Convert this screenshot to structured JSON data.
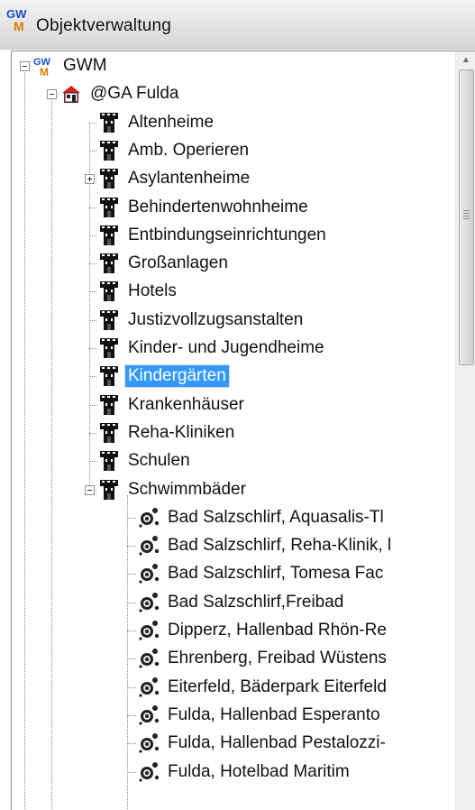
{
  "window": {
    "title": "Objektverwaltung"
  },
  "tree": {
    "root": {
      "label": "GWM",
      "expanded": true
    },
    "office": {
      "label": "@GA Fulda",
      "expanded": true
    },
    "categories": [
      {
        "label": "Altenheime"
      },
      {
        "label": "Amb. Operieren"
      },
      {
        "label": "Asylantenheime",
        "expandable": true
      },
      {
        "label": "Behindertenwohnheime"
      },
      {
        "label": "Entbindungseinrichtungen"
      },
      {
        "label": "Großanlagen"
      },
      {
        "label": "Hotels"
      },
      {
        "label": "Justizvollzugsanstalten"
      },
      {
        "label": "Kinder- und Jugendheime"
      },
      {
        "label": "Kindergärten",
        "selected": true
      },
      {
        "label": "Krankenhäuser"
      },
      {
        "label": "Reha-Kliniken"
      },
      {
        "label": "Schulen"
      },
      {
        "label": "Schwimmbäder",
        "expanded": true
      }
    ],
    "pools": [
      {
        "label": "Bad Salzschlirf, Aquasalis-Tl"
      },
      {
        "label": "Bad Salzschlirf, Reha-Klinik, l"
      },
      {
        "label": "Bad Salzschlirf, Tomesa Fac"
      },
      {
        "label": "Bad Salzschlirf,Freibad"
      },
      {
        "label": "Dipperz, Hallenbad Rhön-Re"
      },
      {
        "label": "Ehrenberg, Freibad Wüstens"
      },
      {
        "label": "Eiterfeld, Bäderpark Eiterfeld"
      },
      {
        "label": "Fulda, Hallenbad Esperanto"
      },
      {
        "label": "Fulda, Hallenbad Pestalozzi-"
      },
      {
        "label": "Fulda, Hotelbad Maritim"
      }
    ]
  },
  "icons": {
    "app": "gwm-logo-icon",
    "root": "gwm-logo-icon",
    "office": "house-icon",
    "category": "building-icon",
    "object": "pool-object-icon"
  },
  "colors": {
    "selection": "#3399ff",
    "house_roof": "#d32020",
    "logo_blue": "#1f4fc4",
    "logo_orange": "#e07a00"
  }
}
